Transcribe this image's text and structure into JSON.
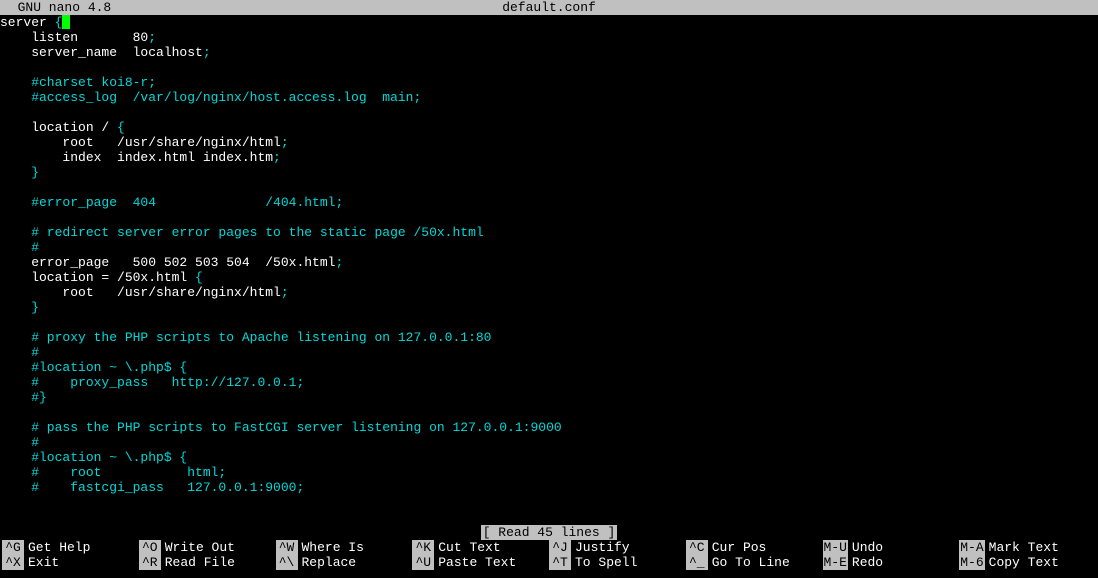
{
  "titlebar": {
    "app": "  GNU nano 4.8",
    "filename": "default.conf"
  },
  "lines": [
    {
      "segs": [
        {
          "t": "server ",
          "c": "white"
        },
        {
          "t": "{",
          "c": "cyan"
        }
      ],
      "cursor": true
    },
    {
      "segs": [
        {
          "t": "    listen       80",
          "c": "white"
        },
        {
          "t": ";",
          "c": "cyan"
        }
      ]
    },
    {
      "segs": [
        {
          "t": "    server_name  localhost",
          "c": "white"
        },
        {
          "t": ";",
          "c": "cyan"
        }
      ]
    },
    {
      "segs": []
    },
    {
      "segs": [
        {
          "t": "    #charset koi8-r;",
          "c": "cyan"
        }
      ]
    },
    {
      "segs": [
        {
          "t": "    #access_log  /var/log/nginx/host.access.log  main;",
          "c": "cyan"
        }
      ]
    },
    {
      "segs": []
    },
    {
      "segs": [
        {
          "t": "    location / ",
          "c": "white"
        },
        {
          "t": "{",
          "c": "cyan"
        }
      ]
    },
    {
      "segs": [
        {
          "t": "        root   /usr/share/nginx/html",
          "c": "white"
        },
        {
          "t": ";",
          "c": "cyan"
        }
      ]
    },
    {
      "segs": [
        {
          "t": "        index  index.html index.htm",
          "c": "white"
        },
        {
          "t": ";",
          "c": "cyan"
        }
      ]
    },
    {
      "segs": [
        {
          "t": "    ",
          "c": "white"
        },
        {
          "t": "}",
          "c": "cyan"
        }
      ]
    },
    {
      "segs": []
    },
    {
      "segs": [
        {
          "t": "    #error_page  404              /404.html;",
          "c": "cyan"
        }
      ]
    },
    {
      "segs": []
    },
    {
      "segs": [
        {
          "t": "    # redirect server error pages to the static page /50x.html",
          "c": "cyan"
        }
      ]
    },
    {
      "segs": [
        {
          "t": "    #",
          "c": "cyan"
        }
      ]
    },
    {
      "segs": [
        {
          "t": "    error_page   500 502 503 504  /50x.html",
          "c": "white"
        },
        {
          "t": ";",
          "c": "cyan"
        }
      ]
    },
    {
      "segs": [
        {
          "t": "    location = /50x.html ",
          "c": "white"
        },
        {
          "t": "{",
          "c": "cyan"
        }
      ]
    },
    {
      "segs": [
        {
          "t": "        root   /usr/share/nginx/html",
          "c": "white"
        },
        {
          "t": ";",
          "c": "cyan"
        }
      ]
    },
    {
      "segs": [
        {
          "t": "    ",
          "c": "white"
        },
        {
          "t": "}",
          "c": "cyan"
        }
      ]
    },
    {
      "segs": []
    },
    {
      "segs": [
        {
          "t": "    # proxy the PHP scripts to Apache listening on 127.0.0.1:80",
          "c": "cyan"
        }
      ]
    },
    {
      "segs": [
        {
          "t": "    #",
          "c": "cyan"
        }
      ]
    },
    {
      "segs": [
        {
          "t": "    #location ~ \\.php$ {",
          "c": "cyan"
        }
      ]
    },
    {
      "segs": [
        {
          "t": "    #    proxy_pass   http://127.0.0.1;",
          "c": "cyan"
        }
      ]
    },
    {
      "segs": [
        {
          "t": "    #}",
          "c": "cyan"
        }
      ]
    },
    {
      "segs": []
    },
    {
      "segs": [
        {
          "t": "    # pass the PHP scripts to FastCGI server listening on 127.0.0.1:9000",
          "c": "cyan"
        }
      ]
    },
    {
      "segs": [
        {
          "t": "    #",
          "c": "cyan"
        }
      ]
    },
    {
      "segs": [
        {
          "t": "    #location ~ \\.php$ {",
          "c": "cyan"
        }
      ]
    },
    {
      "segs": [
        {
          "t": "    #    root           html;",
          "c": "cyan"
        }
      ]
    },
    {
      "segs": [
        {
          "t": "    #    fastcgi_pass   127.0.0.1:9000;",
          "c": "cyan"
        }
      ]
    }
  ],
  "blank_lines_after": 2,
  "status": "[ Read 45 lines ]",
  "shortcuts": [
    [
      {
        "key": "^G",
        "desc": "Get Help"
      },
      {
        "key": "^O",
        "desc": "Write Out"
      },
      {
        "key": "^W",
        "desc": "Where Is"
      },
      {
        "key": "^K",
        "desc": "Cut Text"
      },
      {
        "key": "^J",
        "desc": "Justify"
      },
      {
        "key": "^C",
        "desc": "Cur Pos"
      },
      {
        "key": "M-U",
        "desc": "Undo"
      },
      {
        "key": "M-A",
        "desc": "Mark Text"
      }
    ],
    [
      {
        "key": "^X",
        "desc": "Exit"
      },
      {
        "key": "^R",
        "desc": "Read File"
      },
      {
        "key": "^\\",
        "desc": "Replace"
      },
      {
        "key": "^U",
        "desc": "Paste Text"
      },
      {
        "key": "^T",
        "desc": "To Spell"
      },
      {
        "key": "^_",
        "desc": "Go To Line"
      },
      {
        "key": "M-E",
        "desc": "Redo"
      },
      {
        "key": "M-6",
        "desc": "Copy Text"
      }
    ]
  ]
}
